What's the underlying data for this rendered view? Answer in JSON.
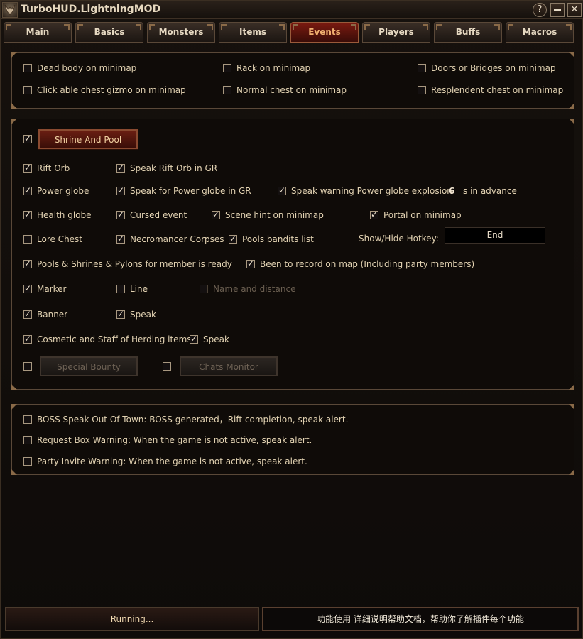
{
  "app": {
    "title": "TurboHUD.LightningMOD",
    "help_label": "?",
    "minimize_label": "",
    "close_label": "✕"
  },
  "tabs": [
    {
      "label": "Main"
    },
    {
      "label": "Basics"
    },
    {
      "label": "Monsters"
    },
    {
      "label": "Items"
    },
    {
      "label": "Events",
      "active": true
    },
    {
      "label": "Players"
    },
    {
      "label": "Buffs"
    },
    {
      "label": "Macros"
    }
  ],
  "minimap_panel": {
    "dead_body": {
      "label": "Dead body on minimap",
      "checked": false
    },
    "rack": {
      "label": "Rack on minimap",
      "checked": false
    },
    "doors": {
      "label": "Doors or Bridges on minimap",
      "checked": false
    },
    "click_chest": {
      "label": "Click able chest gizmo on minimap",
      "checked": false
    },
    "normal_chest": {
      "label": "Normal chest on minimap",
      "checked": false
    },
    "resplendent": {
      "label": "Resplendent chest on minimap",
      "checked": false
    }
  },
  "events_panel": {
    "shrine_toggle": {
      "checked": true
    },
    "shrine_button": "Shrine And Pool",
    "rift_orb": {
      "label": "Rift Orb",
      "checked": true
    },
    "speak_rift_orb": {
      "label": "Speak Rift Orb in GR",
      "checked": true
    },
    "power_globe": {
      "label": "Power globe",
      "checked": true
    },
    "speak_power_globe": {
      "label": "Speak for Power globe in GR",
      "checked": true
    },
    "speak_warning": {
      "label": "Speak warning Power globe explosion",
      "checked": true
    },
    "advance_value": "6",
    "advance_suffix": "s in advance",
    "health_globe": {
      "label": "Health globe",
      "checked": true
    },
    "cursed_event": {
      "label": "Cursed event",
      "checked": true
    },
    "scene_hint": {
      "label": "Scene hint on minimap",
      "checked": true
    },
    "portal": {
      "label": "Portal on minimap",
      "checked": true
    },
    "lore_chest": {
      "label": "Lore Chest",
      "checked": false
    },
    "necro_corpses": {
      "label": "Necromancer Corpses",
      "checked": true
    },
    "pools_bandits": {
      "label": "Pools bandits list",
      "checked": true
    },
    "hotkey_label": "Show/Hide Hotkey:",
    "hotkey_value": "End",
    "pools_ready": {
      "label": "Pools & Shrines & Pylons for member is ready",
      "checked": true
    },
    "been_to_record": {
      "label": "Been to record on map (Including party members)",
      "checked": true
    },
    "marker": {
      "label": "Marker",
      "checked": true
    },
    "line": {
      "label": "Line",
      "checked": false
    },
    "name_distance": {
      "label": "Name and distance",
      "checked": false,
      "disabled": true
    },
    "banner": {
      "label": "Banner",
      "checked": true
    },
    "banner_speak": {
      "label": "Speak",
      "checked": true
    },
    "cosmetic": {
      "label": "Cosmetic and Staff of Herding items",
      "checked": true
    },
    "cosmetic_speak": {
      "label": "Speak",
      "checked": true
    },
    "special_bounty_toggle": {
      "checked": false
    },
    "special_bounty_button": "Special Bounty",
    "chats_monitor_toggle": {
      "checked": false
    },
    "chats_monitor_button": "Chats Monitor"
  },
  "alerts_panel": {
    "boss_speak": {
      "label": "BOSS Speak Out Of Town: BOSS generated，Rift completion, speak alert.",
      "checked": false
    },
    "request_box": {
      "label": "Request Box Warning: When the game is not active, speak alert.",
      "checked": false
    },
    "party_invite": {
      "label": "Party Invite Warning: When the game is not active, speak alert.",
      "checked": false
    }
  },
  "status": {
    "running": "Running...",
    "help_text": "功能使用 详细说明帮助文档，帮助你了解插件每个功能"
  }
}
